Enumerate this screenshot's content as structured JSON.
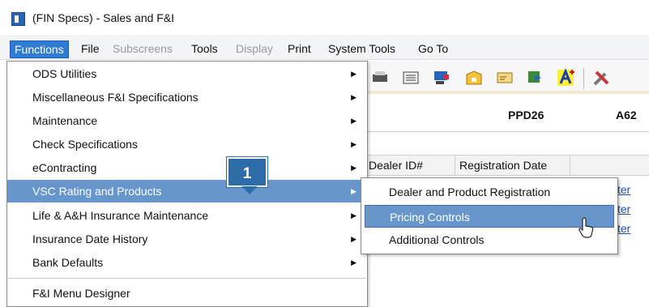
{
  "window": {
    "title": "(FIN Specs) - Sales and F&I"
  },
  "menubar": {
    "items": [
      {
        "id": "functions",
        "label": "Functions",
        "state": "active"
      },
      {
        "id": "file",
        "label": "File",
        "state": "normal"
      },
      {
        "id": "subscreens",
        "label": "Subscreens",
        "state": "disabled"
      },
      {
        "id": "tools",
        "label": "Tools",
        "state": "normal"
      },
      {
        "id": "display",
        "label": "Display",
        "state": "disabled"
      },
      {
        "id": "print",
        "label": "Print",
        "state": "normal"
      },
      {
        "id": "system_tools",
        "label": "System Tools",
        "state": "normal"
      },
      {
        "id": "go_to",
        "label": "Go To",
        "state": "normal"
      }
    ]
  },
  "toolbar": {
    "icons": [
      "printer-icon",
      "keyboard-icon",
      "computer-icon",
      "folder-icon",
      "card-icon",
      "arrow-icon",
      "font-add-icon",
      "tools-icon"
    ]
  },
  "content": {
    "label_ppd": "PPD26",
    "label_a62": "A62",
    "grid_columns": [
      "Dealer ID#",
      "Registration Date"
    ],
    "link_text": "ter"
  },
  "dropdown": {
    "items": [
      {
        "label": "ODS Utilities",
        "submenu": true
      },
      {
        "label": "Miscellaneous F&I Specifications",
        "submenu": true
      },
      {
        "label": "Maintenance",
        "submenu": true
      },
      {
        "label": "Check Specifications",
        "submenu": true
      },
      {
        "label": "eContracting",
        "submenu": true
      },
      {
        "label": "VSC Rating and Products",
        "submenu": true,
        "highlight": true
      },
      {
        "label": "Life & A&H Insurance Maintenance",
        "submenu": true
      },
      {
        "label": "Insurance Date History",
        "submenu": true
      },
      {
        "label": "Bank Defaults",
        "submenu": true
      },
      {
        "label": "F&I Menu Designer",
        "submenu": false
      }
    ]
  },
  "submenu": {
    "items": [
      {
        "label": "Dealer and Product Registration"
      },
      {
        "label": "Pricing Controls",
        "highlight": true
      },
      {
        "label": "Additional Controls"
      }
    ]
  },
  "callout": {
    "number": "1"
  },
  "colors": {
    "menu_active": "#2f7cd6",
    "highlight": "#6696cc",
    "callout": "#2d6ca9",
    "link": "#1a4fb5"
  }
}
